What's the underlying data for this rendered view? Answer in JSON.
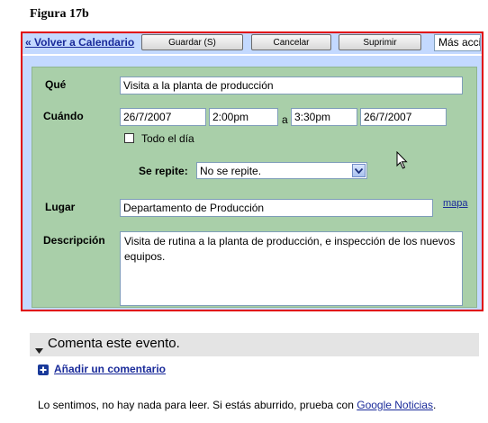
{
  "caption": "Figura 17b",
  "toolbar": {
    "back_link": "« Volver a Calendario",
    "save_label": "Guardar (S)",
    "cancel_label": "Cancelar",
    "delete_label": "Suprimir",
    "more_actions": "Más acci"
  },
  "form": {
    "what_label": "Qué",
    "what_value": "Visita a la planta de producción",
    "when_label": "Cuándo",
    "start_date": "26/7/2007",
    "start_time": "2:00pm",
    "to_label": "a",
    "end_time": "3:30pm",
    "end_date": "26/7/2007",
    "all_day_label": "Todo el día",
    "all_day_checked": false,
    "repeat_label": "Se repite:",
    "repeat_value": "No se repite.",
    "where_label": "Lugar",
    "where_value": "Departamento de Producción",
    "map_link": "mapa",
    "description_label": "Descripción",
    "description_value": "Visita de rutina a la planta de producción, e inspección de los nuevos equipos."
  },
  "comments": {
    "header": "Comenta este evento.",
    "add_comment": "Añadir un comentario",
    "empty_text": "Lo sentimos, no hay nada para leer. Si estás aburrido, prueba con ",
    "news_link": "Google Noticias",
    "period": "."
  },
  "colors": {
    "highlight": "#e00000",
    "panel_green": "#a9cfa9",
    "toolbar_blue": "#c3d9ff",
    "link": "#1a2b9a"
  }
}
